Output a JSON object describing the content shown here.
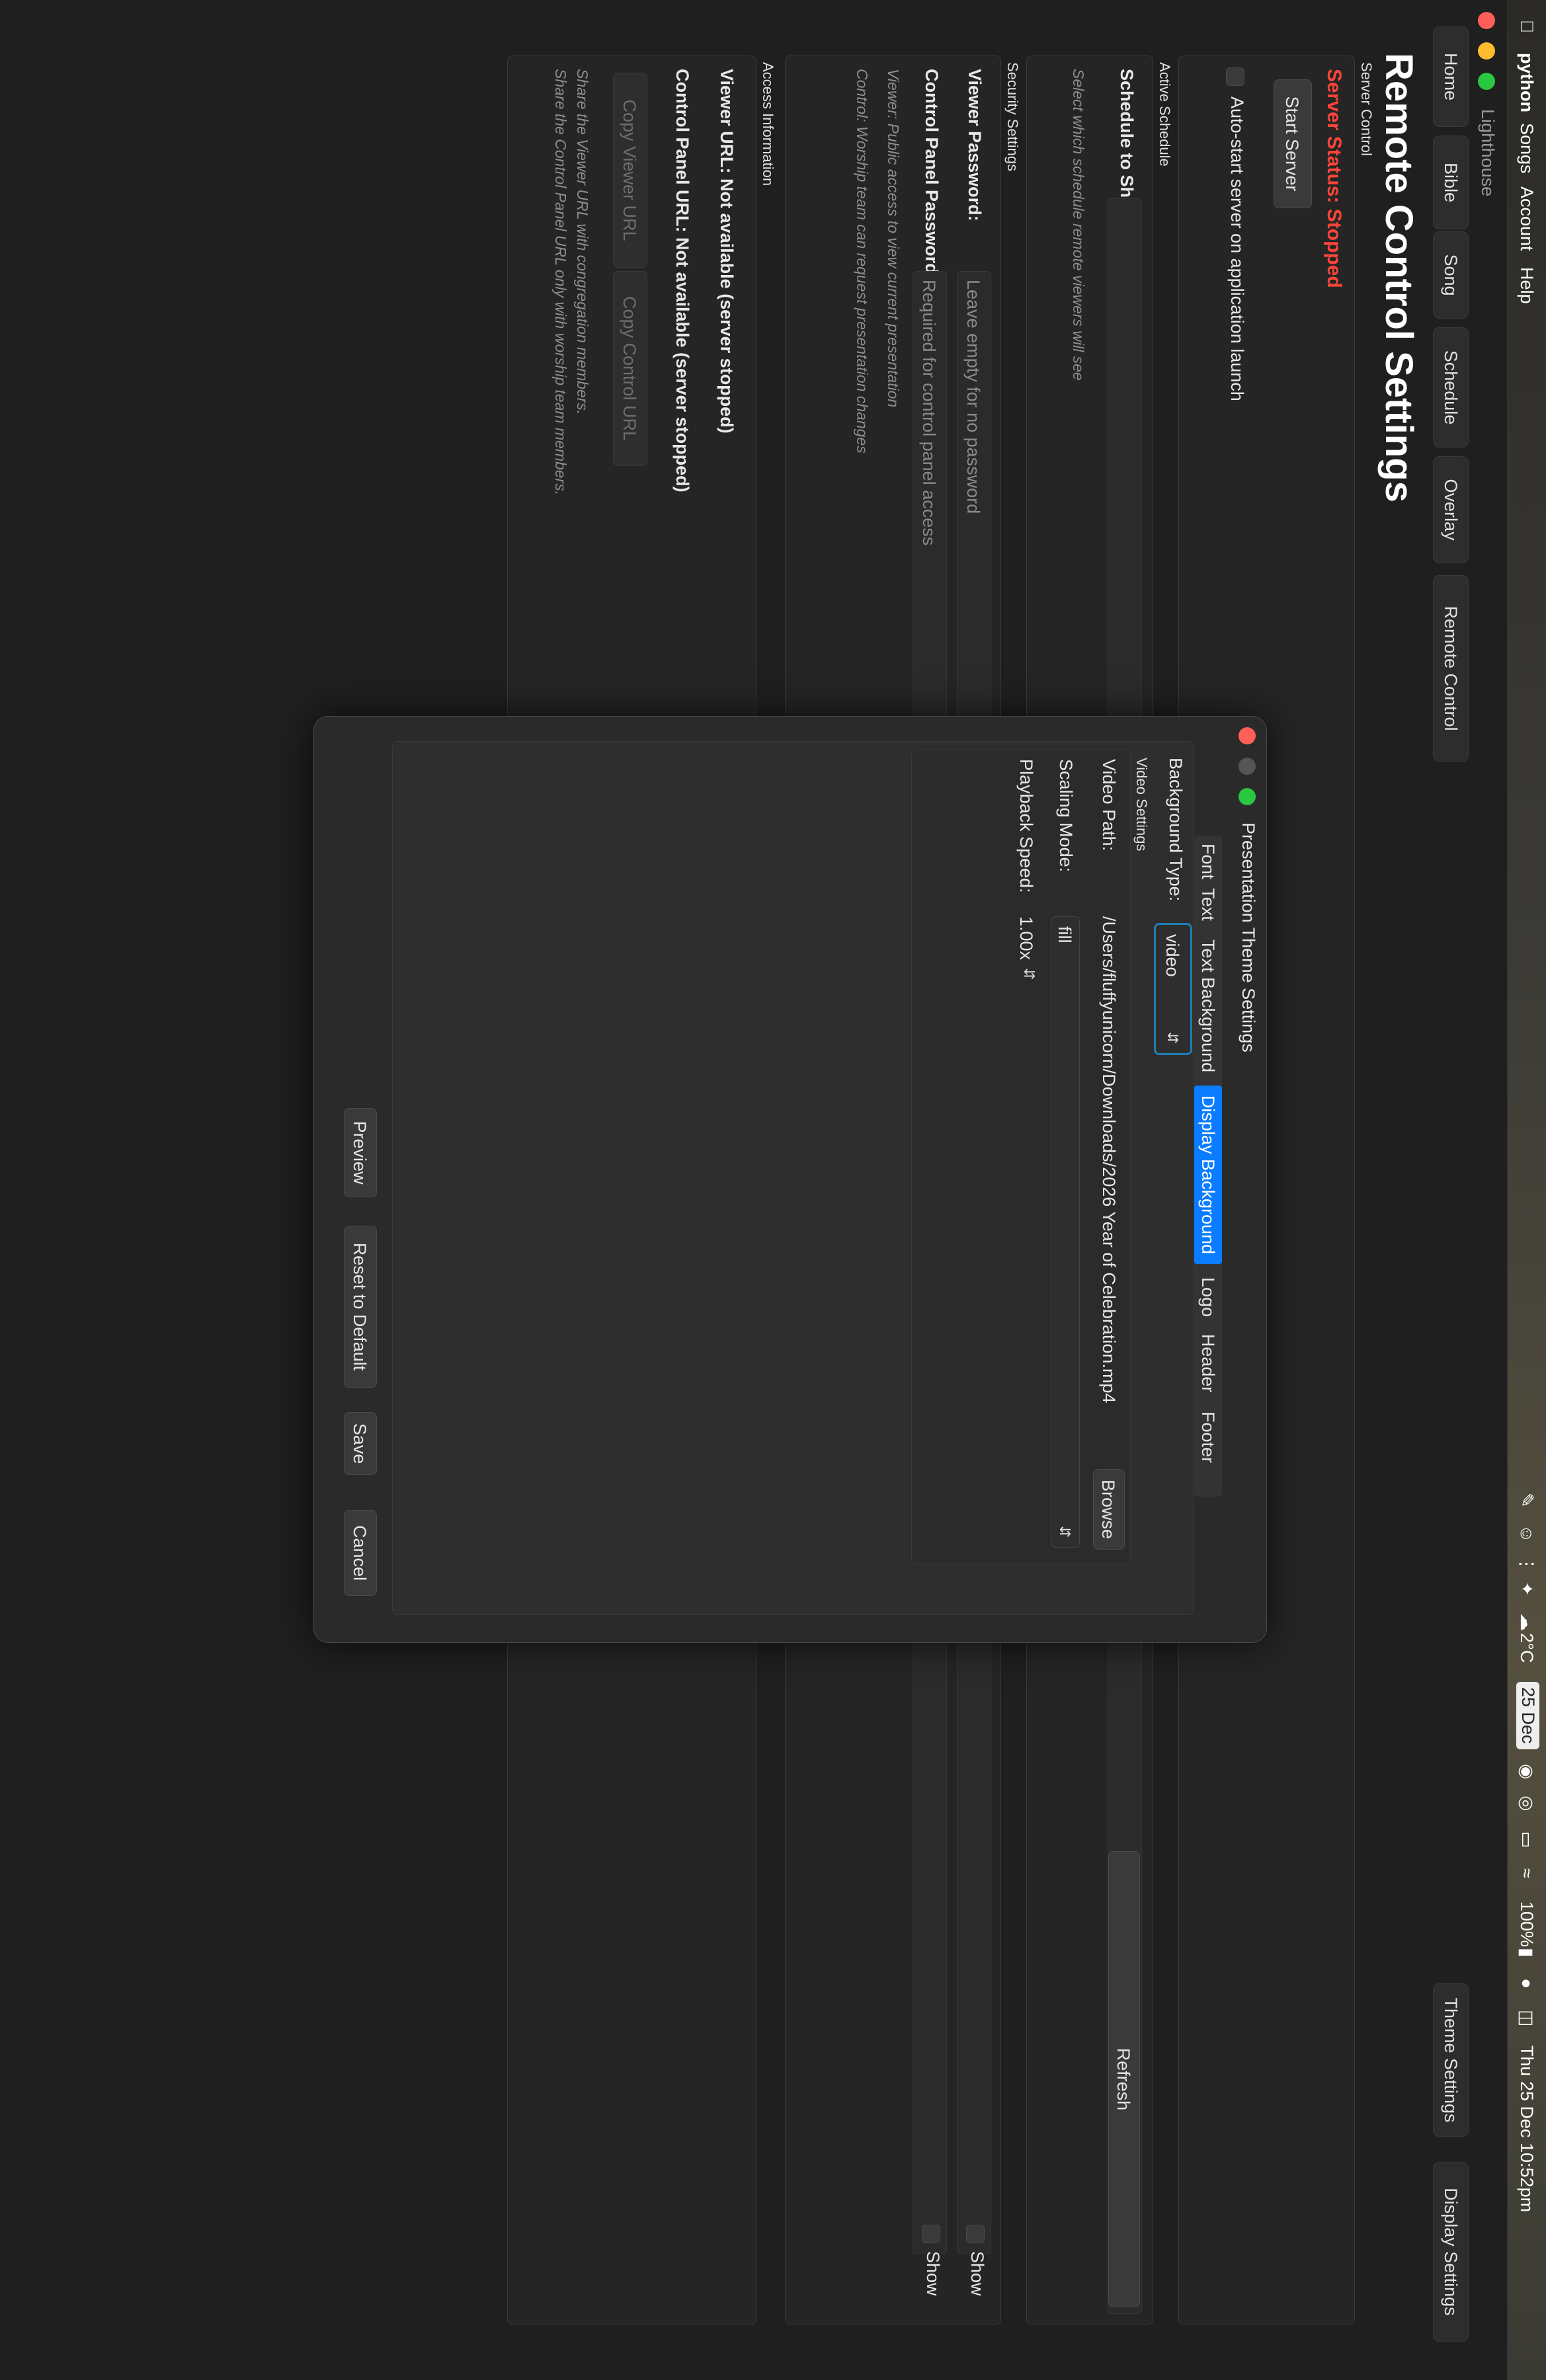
{
  "menubar": {
    "app_name": "python",
    "menus": [
      "Songs",
      "Account",
      "Help"
    ],
    "weather": "2°C",
    "date_badge": "25 Dec",
    "battery": "100%",
    "clock": "Thu 25 Dec  10:52pm"
  },
  "window": {
    "title": "Lighthouse",
    "nav_tabs": [
      "Home",
      "Bible",
      "Song",
      "Schedule",
      "Overlay",
      "Remote Control"
    ],
    "right_buttons": [
      "Theme Settings",
      "Display Settings"
    ]
  },
  "remote": {
    "heading": "Remote Control Settings",
    "server_control_label": "Server Control",
    "server_status": "Server Status: Stopped",
    "start_server": "Start Server",
    "autostart": "Auto-start server on application launch",
    "active_schedule_label": "Active Schedule",
    "schedule_to_share": "Schedule to Share:",
    "refresh": "Refresh",
    "schedule_hint": "Select which schedule remote viewers will see",
    "security_label": "Security Settings",
    "viewer_password": "Viewer Password:",
    "viewer_password_placeholder": "Leave empty for no password",
    "control_password": "Control Panel Password:",
    "control_password_placeholder": "Required for control panel access",
    "show": "Show",
    "viewer_hint": "Viewer: Public access to view current presentation",
    "control_hint": "Control: Worship team can request presentation changes",
    "access_label": "Access Information",
    "viewer_url": "Viewer URL: Not available (server stopped)",
    "control_url": "Control Panel URL: Not available (server stopped)",
    "copy_viewer": "Copy Viewer URL",
    "copy_control": "Copy Control URL",
    "share_hint_1": "Share the Viewer URL with congregation members.",
    "share_hint_2": "Share the Control Panel URL only with worship team members."
  },
  "dialog": {
    "title": "Presentation Theme Settings",
    "tabs": [
      "Font",
      "Text",
      "Text Background",
      "Display Background",
      "Logo",
      "Header",
      "Footer"
    ],
    "active_tab": "Display Background",
    "background_type_label": "Background Type:",
    "background_type_value": "video",
    "video_settings_label": "Video Settings",
    "video_path_label": "Video Path:",
    "video_path_value": "/Users/fluffyunicorn/Downloads/2026 Year of Celebration.mp4",
    "browse": "Browse",
    "scaling_mode_label": "Scaling Mode:",
    "scaling_mode_value": "fill",
    "playback_speed_label": "Playback Speed:",
    "playback_speed_value": "1.00x",
    "buttons": [
      "Preview",
      "Reset to Default",
      "Save",
      "Cancel"
    ]
  },
  "colors": {
    "status_stopped": "#ff453a",
    "accent_blue": "#0a7cff",
    "close": "#ff5f57",
    "minimize": "#febc2e",
    "zoom": "#28c840"
  }
}
